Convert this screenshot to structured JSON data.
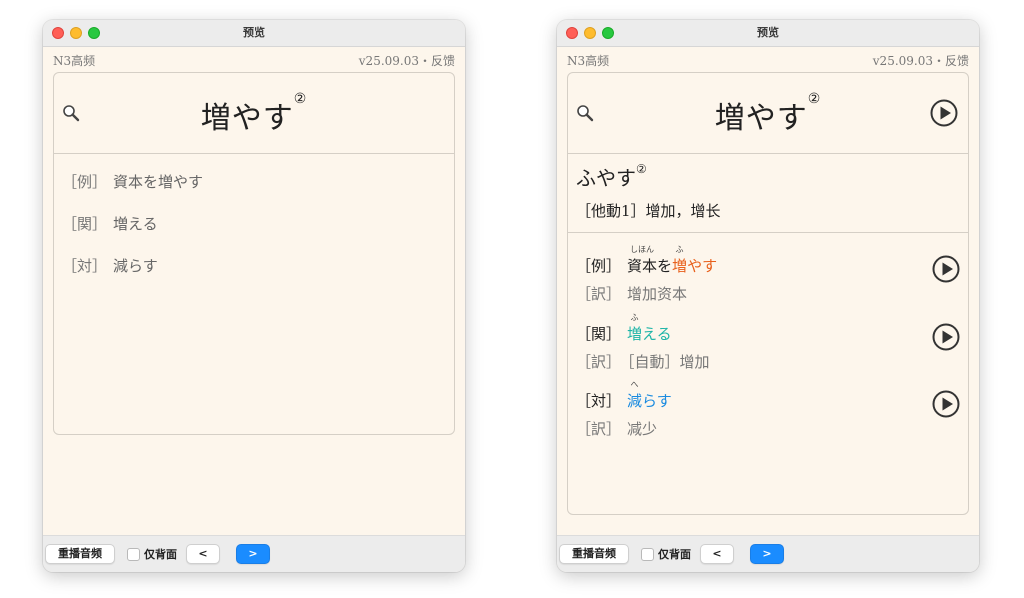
{
  "window_title": "预览",
  "deck_name": "N3高频",
  "version_text": "v25.09.03・反馈",
  "headword": {
    "text": "増やす",
    "accent": "②"
  },
  "front": {
    "relations": [
      {
        "tag": "［例］",
        "text": "資本を増やす"
      },
      {
        "tag": "［関］",
        "text": "増える"
      },
      {
        "tag": "［対］",
        "text": "減らす"
      }
    ]
  },
  "back": {
    "reading": "ふやす",
    "reading_accent": "②",
    "meaning": "［他動1］增加，增长",
    "examples": [
      {
        "tag": "［例］",
        "parts": [
          {
            "text": "資本",
            "ruby": "しほん",
            "hl": ""
          },
          {
            "text": "を",
            "ruby": "",
            "hl": ""
          },
          {
            "text": "増",
            "ruby": "ふ",
            "hl": "orange"
          },
          {
            "text": "やす",
            "ruby": "",
            "hl": "orange"
          }
        ],
        "trans_tag": "［訳］",
        "trans": "增加资本"
      },
      {
        "tag": "［関］",
        "parts": [
          {
            "text": "増",
            "ruby": "ふ",
            "hl": "teal"
          },
          {
            "text": "える",
            "ruby": "",
            "hl": "teal"
          }
        ],
        "trans_tag": "［訳］",
        "trans": "［自動］增加"
      },
      {
        "tag": "［対］",
        "parts": [
          {
            "text": "減",
            "ruby": "へ",
            "hl": "blue"
          },
          {
            "text": "らす",
            "ruby": "",
            "hl": "blue"
          }
        ],
        "trans_tag": "［訳］",
        "trans": "减少"
      }
    ]
  },
  "toolbar": {
    "replay_label": "重播音频",
    "back_only_label": "仅背面",
    "back_only_checked": false,
    "prev_label": "<",
    "next_label": ">"
  },
  "colors": {
    "orange": "#e8601c",
    "teal": "#1fb5a8",
    "blue": "#1a8be0",
    "next_button": "#1a8cff"
  }
}
